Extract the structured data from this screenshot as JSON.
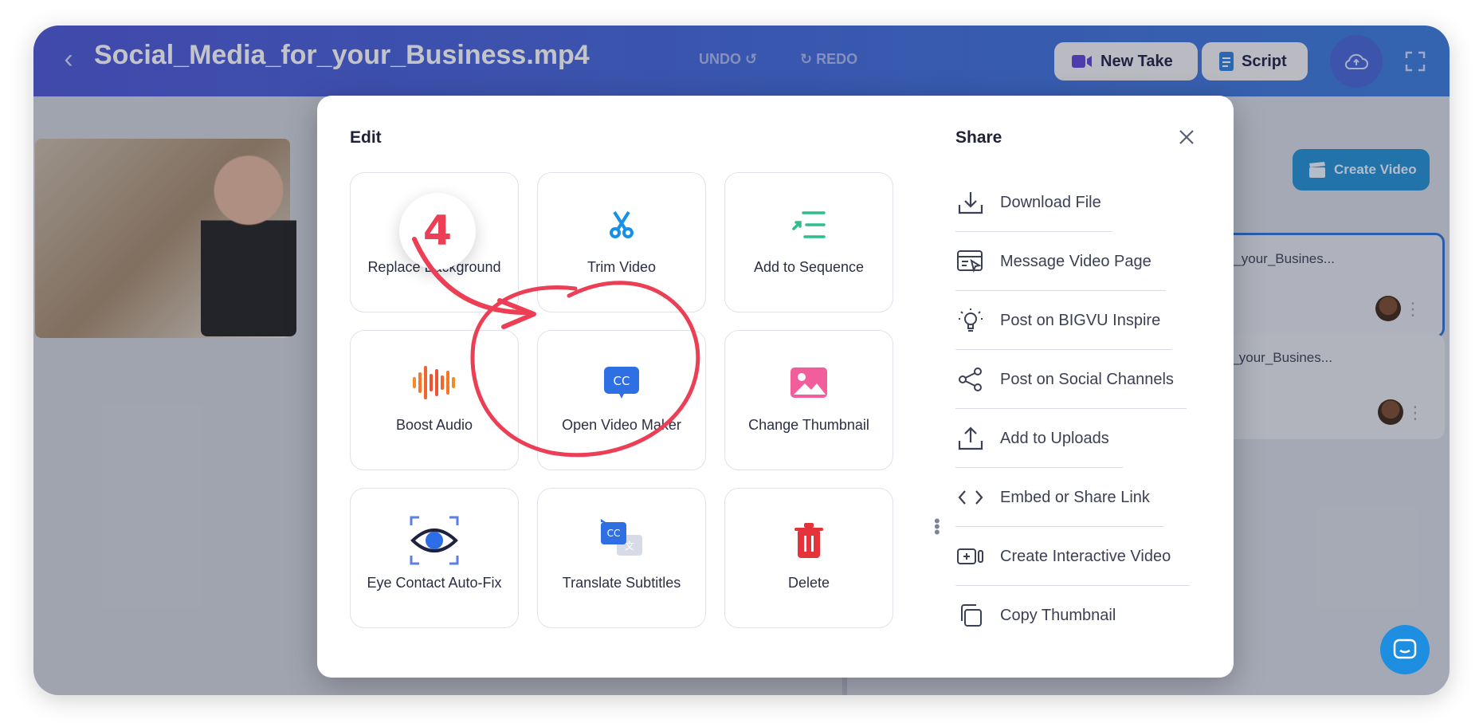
{
  "window": {
    "title": "Social_Media_for_your_Business.mp4",
    "undo_label": "UNDO",
    "redo_label": "REDO",
    "new_take_label": "New Take",
    "script_label": "Script"
  },
  "right_panel": {
    "create_video_label": "Create Video",
    "takes": [
      {
        "name": "_for_your_Busines..."
      },
      {
        "name": "_for_your_Busines..."
      }
    ]
  },
  "modal": {
    "edit_title": "Edit",
    "share_title": "Share",
    "edit_tiles": [
      {
        "label": "Replace Background",
        "icon": "replace-background-icon"
      },
      {
        "label": "Trim Video",
        "icon": "scissors-icon"
      },
      {
        "label": "Add to Sequence",
        "icon": "sequence-icon"
      },
      {
        "label": "Boost Audio",
        "icon": "audio-wave-icon"
      },
      {
        "label": "Open Video Maker",
        "icon": "closed-captions-icon"
      },
      {
        "label": "Change Thumbnail",
        "icon": "image-icon"
      },
      {
        "label": "Eye Contact Auto-Fix",
        "icon": "eye-icon"
      },
      {
        "label": "Translate Subtitles",
        "icon": "translate-subtitles-icon"
      },
      {
        "label": "Delete",
        "icon": "trash-icon"
      }
    ],
    "share_items": [
      {
        "label": "Download File",
        "icon": "download-icon"
      },
      {
        "label": "Message Video Page",
        "icon": "message-page-icon"
      },
      {
        "label": "Post on BIGVU Inspire",
        "icon": "lightbulb-icon"
      },
      {
        "label": "Post on Social Channels",
        "icon": "share-nodes-icon"
      },
      {
        "label": "Add to Uploads",
        "icon": "upload-icon"
      },
      {
        "label": "Embed or Share Link",
        "icon": "code-icon"
      },
      {
        "label": "Create Interactive Video",
        "icon": "interactive-video-icon"
      },
      {
        "label": "Copy Thumbnail",
        "icon": "copy-icon"
      }
    ]
  },
  "annotation": {
    "step_number": "4",
    "color": "#ec3f55"
  },
  "colors": {
    "topbar": "#4b55d6",
    "accent_blue": "#1f8fd4",
    "annotation_red": "#ec3f55"
  }
}
